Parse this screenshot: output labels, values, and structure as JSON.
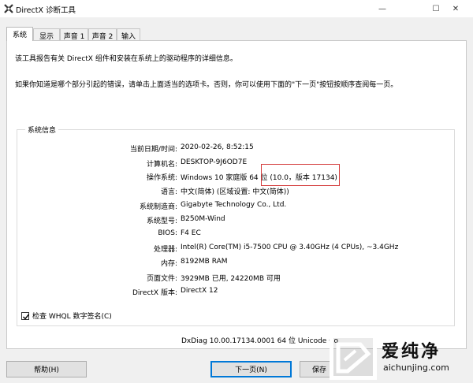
{
  "window": {
    "title": "DirectX 诊断工具",
    "controls": {
      "minimize": "—",
      "maximize": "☐",
      "close": "✕"
    }
  },
  "tabs": [
    {
      "label": "系统",
      "active": true
    },
    {
      "label": "显示"
    },
    {
      "label": "声音 1"
    },
    {
      "label": "声音 2"
    },
    {
      "label": "输入"
    }
  ],
  "intro": {
    "line1": "该工具报告有关 DirectX 组件和安装在系统上的驱动程序的详细信息。",
    "line2": "如果你知道是哪个部分引起的错误，请单击上面适当的选项卡。否则，你可以使用下面的\"下一页\"按钮按顺序查阅每一页。"
  },
  "system_info": {
    "group_title": "系统信息",
    "rows": [
      {
        "label": "当前日期/时间:",
        "value": "2020-02-26, 8:52:15"
      },
      {
        "label": "计算机名:",
        "value": "DESKTOP-9J6OD7E"
      },
      {
        "label": "操作系统:",
        "value": "Windows 10 家庭版 64 位 (10.0，版本 17134)"
      },
      {
        "label": "语言:",
        "value": "中文(简体) (区域设置: 中文(简体))"
      },
      {
        "label": "系统制造商:",
        "value": "Gigabyte Technology Co., Ltd."
      },
      {
        "label": "系统型号:",
        "value": "B250M-Wind"
      },
      {
        "label": "BIOS:",
        "value": "F4 EC"
      },
      {
        "label": "处理器:",
        "value": "Intel(R) Core(TM) i5-7500 CPU @ 3.40GHz (4 CPUs), ~3.4GHz"
      },
      {
        "label": "内存:",
        "value": "8192MB RAM"
      },
      {
        "label": "页面文件:",
        "value": "3929MB 已用, 24220MB 可用"
      },
      {
        "label": "DirectX 版本:",
        "value": "DirectX 12"
      }
    ]
  },
  "whql": {
    "label": "检查 WHQL 数字签名(C)",
    "checked": true
  },
  "footer": "DxDiag 10.00.17134.0001 64 位 Unicode  Co",
  "buttons": {
    "help": "帮助(H)",
    "next": "下一页(N)",
    "save": "保存"
  },
  "watermark": {
    "name": "爱纯净",
    "url": "aichunjing.com"
  },
  "colors": {
    "highlight_border": "#d43c3c",
    "focus_border": "#0078d7"
  },
  "icons": {
    "app": "directx-icon",
    "watermark": "aichunjing-logo-icon"
  }
}
